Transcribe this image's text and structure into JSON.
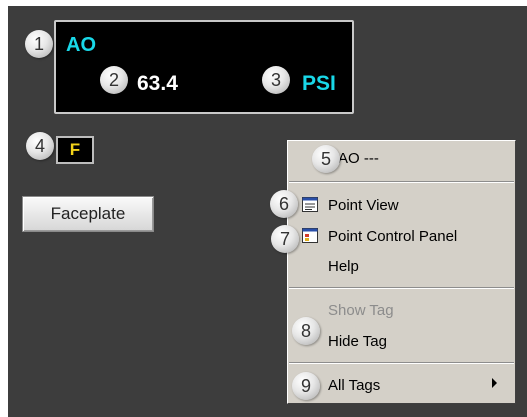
{
  "faceplate_display": {
    "tag": "AO",
    "value": "63.4",
    "units": "PSI",
    "status_letter": "F",
    "faceplate_button": "Faceplate"
  },
  "callouts": [
    "1",
    "2",
    "3",
    "4",
    "5",
    "6",
    "7",
    "8",
    "9"
  ],
  "context_menu": {
    "header": "AO ---",
    "point_view": "Point View",
    "point_control_panel": "Point Control Panel",
    "help": "Help",
    "show_tag": "Show Tag",
    "hide_tag": "Hide Tag",
    "all_tags": "All Tags"
  },
  "colors": {
    "background": "#3d3d3d",
    "tag_cyan": "#19d8e8",
    "status_yellow": "#f3d31a",
    "menu_face": "#d4d0c8"
  },
  "icons": [
    "point-view-icon",
    "point-control-panel-icon",
    "submenu-arrow-icon"
  ]
}
